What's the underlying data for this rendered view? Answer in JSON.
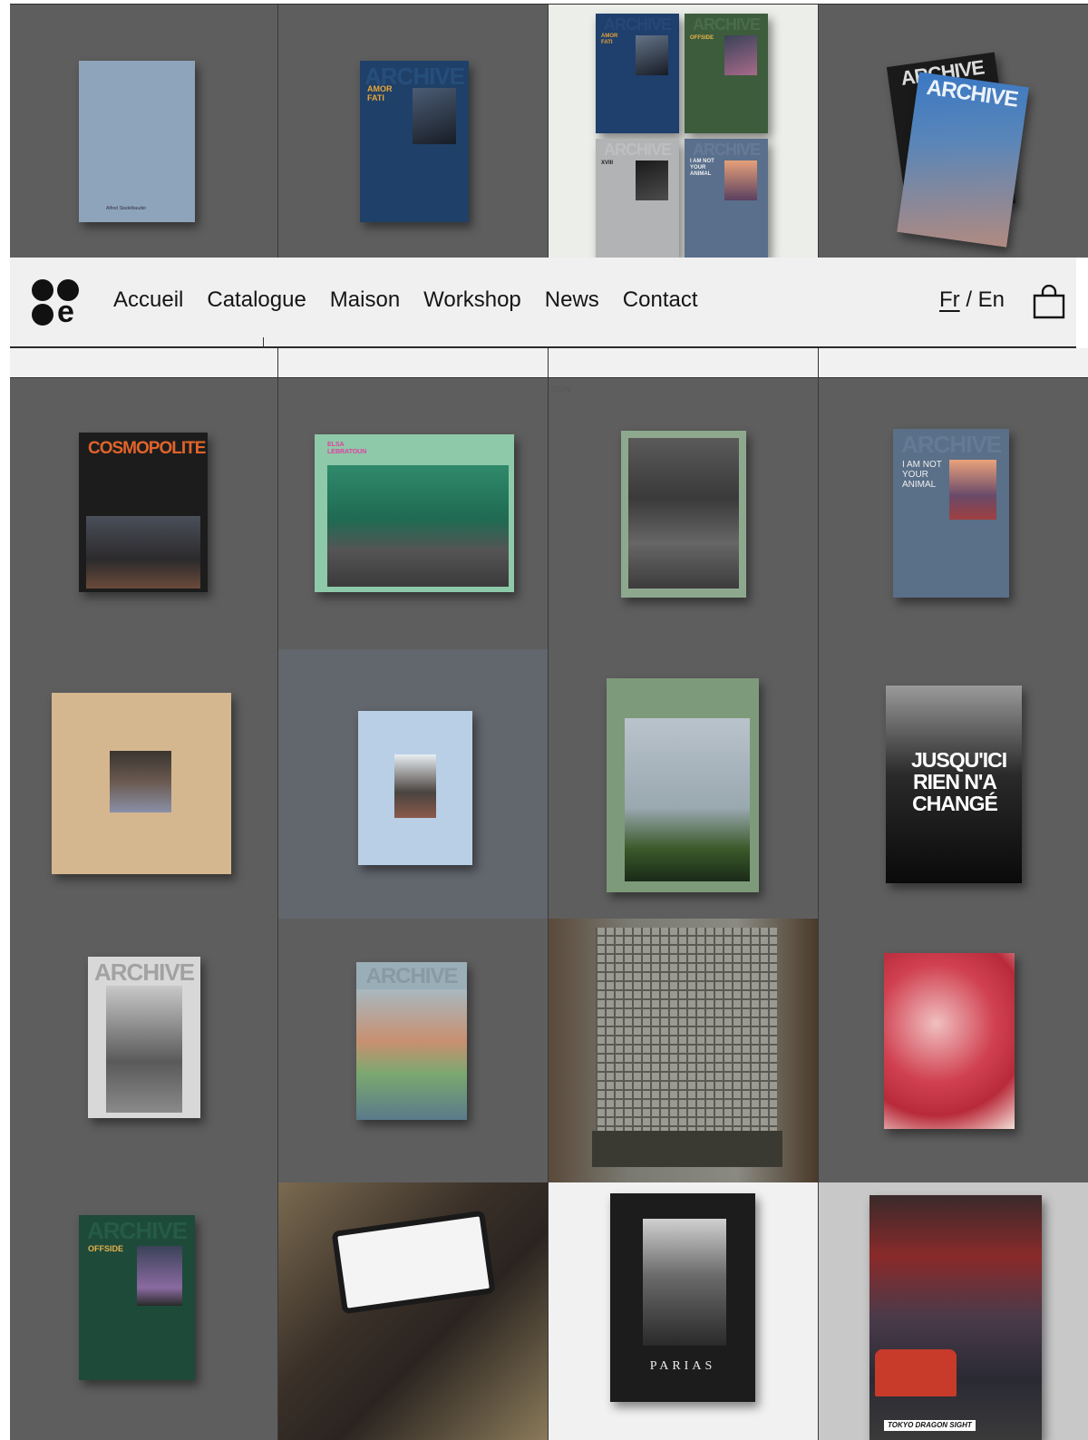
{
  "nav": {
    "items": [
      "Accueil",
      "Catalogue",
      "Maison",
      "Workshop",
      "News",
      "Contact"
    ],
    "lang_fr": "Fr",
    "lang_sep": " / ",
    "lang_en": "En"
  },
  "strip": {
    "text": "ITION"
  },
  "books": {
    "row1": {
      "b1_author": "Alfred Stadelbauder",
      "b2_title": "AMOR FATI",
      "b2_mast": "ARCHIVE",
      "b3_t1": "AMOR FATI",
      "b3_t2": "OFFSIDE",
      "b3_t3": "XVIII",
      "b3_t4": "I AM NOT YOUR ANIMAL",
      "b3_mast": "ARCHIVE",
      "b4_mast": "ARCHIVE"
    },
    "row2": {
      "b1_title": "COSMOPOLITE",
      "b2_title": "ELSA LEBRATOUN",
      "b4_title": "I AM NOT YOUR ANIMAL",
      "b4_mast": "ARCHIVE"
    },
    "row3": {
      "b4_title": "JUSQU'ICI RIEN N'A CHANGÉ"
    },
    "row4": {
      "b1_mast": "ARCHIVE",
      "b2_mast": "ARCHIVE"
    },
    "row5": {
      "b1_mast": "ARCHIVE",
      "b1_title": "OFFSIDE",
      "b3_title": "PARIAS",
      "b4_title": "TOKYO DRAGON SIGHT"
    }
  },
  "colors": {
    "bg_grey": "#5e5e5e",
    "navbar": "#f0f0f0",
    "text": "#151515"
  }
}
